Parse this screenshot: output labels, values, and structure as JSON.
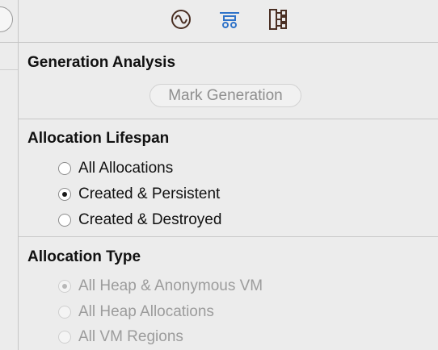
{
  "toolbar": {
    "icons": [
      {
        "name": "record-settings-icon",
        "color": "#4a2f23"
      },
      {
        "name": "display-settings-icon",
        "color": "#2f73c9"
      },
      {
        "name": "extended-detail-icon",
        "color": "#4a2f23"
      }
    ]
  },
  "generation_analysis": {
    "title": "Generation Analysis",
    "mark_button_label": "Mark Generation"
  },
  "allocation_lifespan": {
    "title": "Allocation Lifespan",
    "options": [
      {
        "label": "All Allocations",
        "selected": false
      },
      {
        "label": "Created & Persistent",
        "selected": true
      },
      {
        "label": "Created & Destroyed",
        "selected": false
      }
    ]
  },
  "allocation_type": {
    "title": "Allocation Type",
    "enabled": false,
    "options": [
      {
        "label": "All Heap & Anonymous VM",
        "selected": true
      },
      {
        "label": "All Heap Allocations",
        "selected": false
      },
      {
        "label": "All VM Regions",
        "selected": false
      }
    ]
  }
}
